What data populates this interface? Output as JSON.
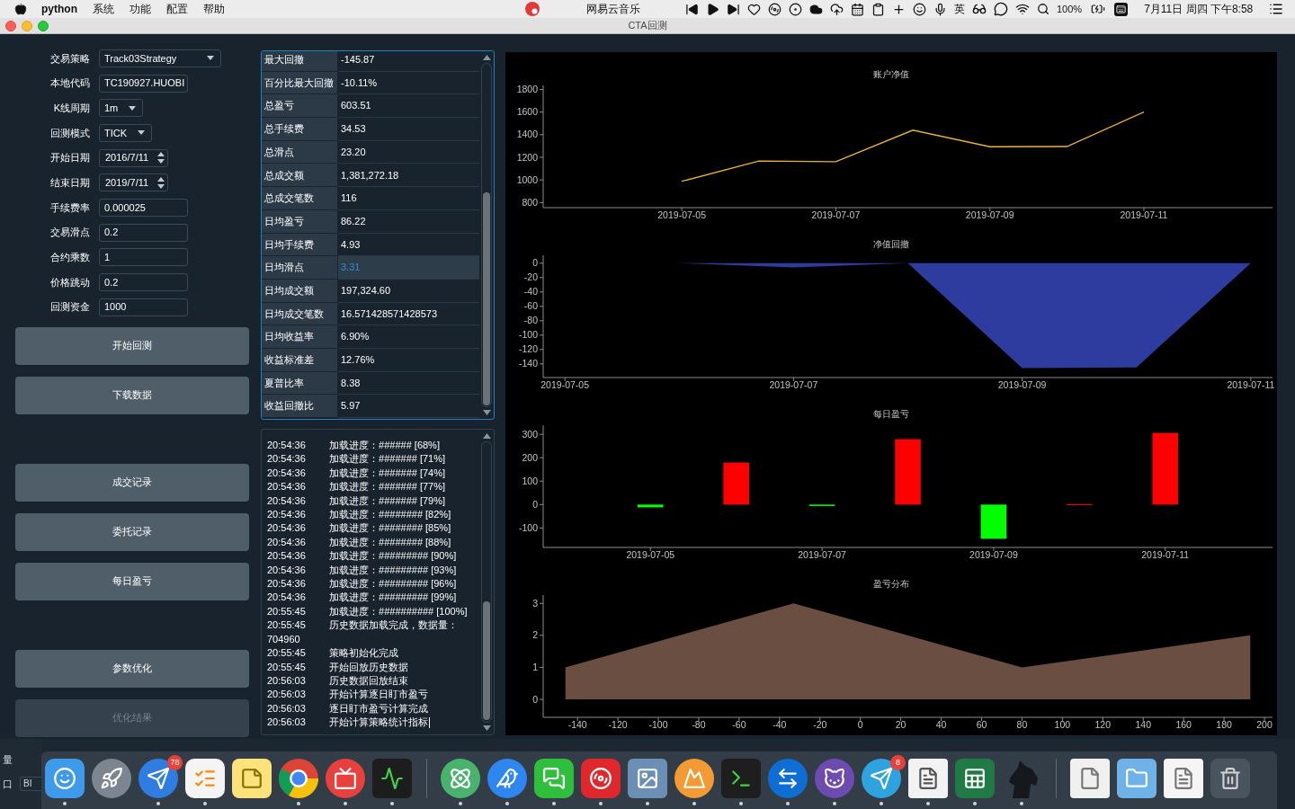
{
  "menu_bar": {
    "app_name": "python",
    "menus": [
      "系统",
      "功能",
      "配置",
      "帮助"
    ],
    "now_playing": "网易云音乐",
    "input_method": "英",
    "battery": "100%",
    "clock": "7月11日 周四 下午8:58"
  },
  "window": {
    "title": "CTA回测"
  },
  "settings": [
    {
      "label": "交易策略",
      "kind": "select",
      "value": "Track03Strategy"
    },
    {
      "label": "本地代码",
      "kind": "text",
      "value": "TC190927.HUOBI"
    },
    {
      "label": "K线周期",
      "kind": "select",
      "value": "1m"
    },
    {
      "label": "回测模式",
      "kind": "select",
      "value": "TICK"
    },
    {
      "label": "开始日期",
      "kind": "date",
      "value": "2016/7/11"
    },
    {
      "label": "结束日期",
      "kind": "date",
      "value": "2019/7/11"
    },
    {
      "label": "手续费率",
      "kind": "text",
      "value": "0.000025"
    },
    {
      "label": "交易滑点",
      "kind": "text",
      "value": "0.2"
    },
    {
      "label": "合约乘数",
      "kind": "text",
      "value": "1"
    },
    {
      "label": "价格跳动",
      "kind": "text",
      "value": "0.2"
    },
    {
      "label": "回测资金",
      "kind": "text",
      "value": "1000"
    }
  ],
  "button_groups": [
    [
      {
        "label": "开始回测",
        "disabled": false
      },
      {
        "label": "下载数据",
        "disabled": false
      }
    ],
    [
      {
        "label": "成交记录",
        "disabled": false
      },
      {
        "label": "委托记录",
        "disabled": false
      },
      {
        "label": "每日盈亏",
        "disabled": false
      }
    ],
    [
      {
        "label": "参数优化",
        "disabled": false
      },
      {
        "label": "优化结果",
        "disabled": true
      }
    ]
  ],
  "statistics": [
    {
      "label": "最大回撤",
      "value": "-145.87",
      "selected": false
    },
    {
      "label": "百分比最大回撤",
      "value": "-10.11%",
      "selected": false
    },
    {
      "label": "总盈亏",
      "value": "603.51",
      "selected": false
    },
    {
      "label": "总手续费",
      "value": "34.53",
      "selected": false
    },
    {
      "label": "总滑点",
      "value": "23.20",
      "selected": false
    },
    {
      "label": "总成交额",
      "value": "1,381,272.18",
      "selected": false
    },
    {
      "label": "总成交笔数",
      "value": "116",
      "selected": false
    },
    {
      "label": "日均盈亏",
      "value": "86.22",
      "selected": false
    },
    {
      "label": "日均手续费",
      "value": "4.93",
      "selected": false
    },
    {
      "label": "日均滑点",
      "value": "3.31",
      "selected": true
    },
    {
      "label": "日均成交额",
      "value": "197,324.60",
      "selected": false
    },
    {
      "label": "日均成交笔数",
      "value": "16.571428571428573",
      "selected": false
    },
    {
      "label": "日均收益率",
      "value": "6.90%",
      "selected": false
    },
    {
      "label": "收益标准差",
      "value": "12.76%",
      "selected": false
    },
    {
      "label": "夏普比率",
      "value": "8.38",
      "selected": false
    },
    {
      "label": "收益回撤比",
      "value": "5.97",
      "selected": false
    }
  ],
  "log": [
    {
      "time": "20:54:36",
      "message": "加载进度：###### [68%]"
    },
    {
      "time": "20:54:36",
      "message": "加载进度：####### [71%]"
    },
    {
      "time": "20:54:36",
      "message": "加载进度：####### [74%]"
    },
    {
      "time": "20:54:36",
      "message": "加载进度：####### [77%]"
    },
    {
      "time": "20:54:36",
      "message": "加载进度：####### [79%]"
    },
    {
      "time": "20:54:36",
      "message": "加载进度：######## [82%]"
    },
    {
      "time": "20:54:36",
      "message": "加载进度：######## [85%]"
    },
    {
      "time": "20:54:36",
      "message": "加载进度：######## [88%]"
    },
    {
      "time": "20:54:36",
      "message": "加载进度：######### [90%]"
    },
    {
      "time": "20:54:36",
      "message": "加载进度：######### [93%]"
    },
    {
      "time": "20:54:36",
      "message": "加载进度：######### [96%]"
    },
    {
      "time": "20:54:36",
      "message": "加载进度：######### [99%]"
    },
    {
      "time": "20:55:45",
      "message": "加载进度：########## [100%]"
    },
    {
      "time": "20:55:45",
      "message": "历史数据加载完成，数据量：704960"
    },
    {
      "time": "20:55:45",
      "message": "策略初始化完成"
    },
    {
      "time": "20:55:45",
      "message": "开始回放历史数据"
    },
    {
      "time": "20:56:03",
      "message": "历史数据回放结束"
    },
    {
      "time": "20:56:03",
      "message": "开始计算逐日盯市盈亏"
    },
    {
      "time": "20:56:03",
      "message": "逐日盯市盈亏计算完成"
    },
    {
      "time": "20:56:03",
      "message": "开始计算策略统计指标"
    }
  ],
  "charts": [
    {
      "chart_data": {
        "type": "line",
        "title": "账户净值",
        "categories": [
          "2019-07-05",
          null,
          "2019-07-07",
          null,
          "2019-07-09",
          null,
          "2019-07-11"
        ],
        "ylim": [
          755,
          1836
        ],
        "yticks": [
          800,
          1000,
          1200,
          1400,
          1600,
          1800
        ],
        "series": [
          {
            "color": "#eab33a",
            "values": [
              988,
              1167,
              1161,
              1440,
              1294,
              1295,
              1601
            ]
          }
        ]
      }
    },
    {
      "chart_data": {
        "type": "area",
        "title": "净值回撤",
        "categories": [
          "2019-07-05",
          null,
          "2019-07-07",
          null,
          "2019-07-09",
          null,
          "2019-07-11"
        ],
        "ylim": [
          -159,
          11
        ],
        "yticks": [
          0,
          -20,
          -40,
          -60,
          -80,
          -100,
          -120,
          -140
        ],
        "series": [
          {
            "color": "#2f3c9f",
            "values": [
              0,
              0,
              -6,
              0,
              -146,
              -145,
              0
            ]
          }
        ]
      }
    },
    {
      "chart_data": {
        "type": "bar",
        "title": "每日盈亏",
        "categories": [
          "2019-07-05",
          null,
          "2019-07-07",
          null,
          "2019-07-09",
          null,
          "2019-07-11"
        ],
        "ylim": [
          -183,
          339
        ],
        "yticks": [
          -100,
          0,
          100,
          200,
          300
        ],
        "stacked": true,
        "series": [
          {
            "color": "#ff0000",
            "values": [
              0,
              179,
              0,
              279,
              0,
              1,
              306
            ]
          },
          {
            "color": "#00ff00",
            "values": [
              -12,
              0,
              -6,
              0,
              -146,
              0,
              0
            ]
          }
        ]
      }
    },
    {
      "chart_data": {
        "type": "area",
        "title": "盈亏分布",
        "x": [
          -146,
          -33,
          80,
          193
        ],
        "xlim": [
          -157,
          204
        ],
        "ylim": [
          -0.56,
          3.26
        ],
        "xticks": [
          -140,
          -120,
          -100,
          -80,
          -60,
          -40,
          -20,
          0,
          20,
          40,
          60,
          80,
          100,
          120,
          140,
          160,
          180,
          200
        ],
        "yticks": [
          0,
          1,
          2,
          3
        ],
        "series": [
          {
            "color": "#6b4e42",
            "values": [
              1,
              3,
              1,
              2
            ]
          }
        ]
      }
    }
  ],
  "background_window": {
    "labels": [
      "量",
      "口"
    ],
    "field_value": "BI"
  },
  "dock": {
    "items": [
      {
        "running": true
      },
      {
        "running": false
      },
      {
        "running": true,
        "badge": "78"
      },
      {
        "running": true
      },
      {
        "running": false
      },
      {
        "running": true
      },
      {
        "running": true
      },
      {
        "running": true
      },
      {
        "running": true
      },
      {
        "running": true
      },
      {
        "running": true
      },
      {
        "running": true
      },
      {
        "running": true
      },
      {
        "running": true
      },
      {
        "running": true
      },
      {
        "running": true
      },
      {
        "running": true
      },
      {
        "running": true,
        "badge": "8"
      },
      {
        "running": true
      },
      {
        "running": true
      },
      {
        "running": true
      },
      {
        "running": false
      },
      {
        "running": false
      },
      {
        "running": false
      },
      {
        "running": false
      }
    ]
  }
}
